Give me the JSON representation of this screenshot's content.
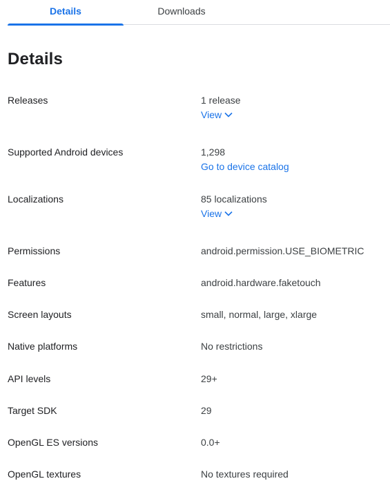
{
  "tabs": {
    "details": "Details",
    "downloads": "Downloads"
  },
  "page": {
    "title": "Details"
  },
  "rows": {
    "releases": {
      "label": "Releases",
      "value": "1 release",
      "link": "View"
    },
    "devices": {
      "label": "Supported Android devices",
      "value": "1,298",
      "link": "Go to device catalog"
    },
    "localizations": {
      "label": "Localizations",
      "value": "85 localizations",
      "link": "View"
    },
    "permissions": {
      "label": "Permissions",
      "value": "android.permission.USE_BIOMETRIC"
    },
    "features": {
      "label": "Features",
      "value": "android.hardware.faketouch"
    },
    "screen_layouts": {
      "label": "Screen layouts",
      "value": "small, normal, large, xlarge"
    },
    "native_platforms": {
      "label": "Native platforms",
      "value": "No restrictions"
    },
    "api_levels": {
      "label": "API levels",
      "value": "29+"
    },
    "target_sdk": {
      "label": "Target SDK",
      "value": "29"
    },
    "opengl_es": {
      "label": "OpenGL ES versions",
      "value": "0.0+"
    },
    "opengl_textures": {
      "label": "OpenGL textures",
      "value": "No textures required"
    }
  },
  "colors": {
    "accent": "#1a73e8",
    "text": "#202124",
    "divider": "#dadce0"
  },
  "icons": {
    "view_toggle": "chevron-down-icon"
  }
}
